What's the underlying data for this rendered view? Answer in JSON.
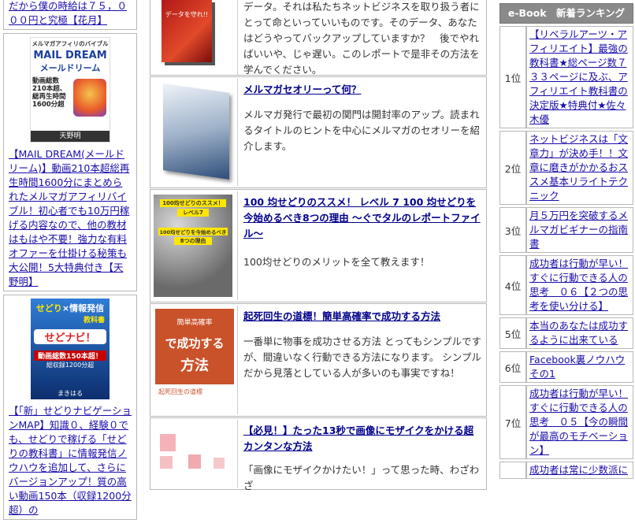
{
  "left": {
    "top_text": "だから僕の時給は７５，０００円と究極【花月】",
    "ad1": {
      "cover_tag": "メルマガアフィリのバイブル",
      "cover_title": "MAIL DREAM",
      "cover_kana": "メールドリーム",
      "cover_lines": [
        "動画総数",
        "210本超、",
        "総再生時間",
        "1600分超"
      ],
      "cover_author": "天野明",
      "link": "【MAIL DREAM(メールドリーム)】動画210本超総再生時間1600分にまとめられたメルマガアフィリバイブル！初心者でも10万円稼げる内容なので、他の教材はもはや不要！強力な有料オファーを仕掛ける秘策も大公開！5大特典付き【天野明】"
    },
    "ad2": {
      "cover_title1": "せどり",
      "cover_title2": "情報発信",
      "cover_title3": "教科書",
      "cover_logo": "せどナビ！",
      "cover_count": "動画総数150本超！",
      "cover_sub": "総収録1200分超",
      "cover_author": "まきはる",
      "link": "【「新」せどりナビゲーションMAP】知識０、経験０でも、せどりで稼げる「せどりの教科書」に情報発信ノウハウを追加して、さらにバージョンアップ！質の高い動画150本（収録1200分超）の"
    }
  },
  "center": {
    "row0": {
      "cover_text": "データを守れ!!",
      "desc": "データ。それは私たちネットビジネスを取り扱う者にとって命といっていいものです。そのデータ、あなたはどうやってバックアップしていますか？　後でやればいいや、じゃ遅い。このレポートで是非その方法を学んでください。"
    },
    "row1": {
      "title": "メルマガセオリーって何？",
      "desc": "メルマガ発行で最初の関門は開封率のアップ。読まれるタイトルのヒントを中心にメルマガのセオリーを紹介します。"
    },
    "row2": {
      "cover_t1": "100均せどりのススメ！",
      "cover_t2": "レベル7",
      "cover_t3": "100均せどりを今始めるべき",
      "cover_t4": "8つの理由",
      "title": "100 均せどりのススメ！ レベル 7 100 均せどりを今始めるべき8つの理由 ～ぐでタルのレポートファイル～",
      "desc": "100均せどりのメリットを全て教えます！"
    },
    "row3": {
      "cover_t1": "簡単高確率",
      "cover_t2": "で成功する",
      "cover_t3": "方法",
      "cover_t4": "起死回生の道標",
      "title": "起死回生の道標！簡単高確率で成功する方法",
      "desc": "一番単に物事を成功させる方法 とってもシンプルですが、間違いなく行動できる方法になります。 シンプルだから見落としている人が多いのも事実ですね！"
    },
    "row4": {
      "title": "【必見！】たった13秒で画像にモザイクをかける超カンタンな方法",
      "desc": "「画像にモザイクかけたい！」って思った時、わざわざ"
    }
  },
  "right": {
    "header": "e-Book　新着ランキング",
    "items": [
      {
        "rank": "1位",
        "title": "【リベラルアーツ・アフィリエイト】最強の教科書★総ページ数７３３ページに及ぶ、アフィリエイト教科書の決定版★特典付★佐々木優"
      },
      {
        "rank": "2位",
        "title": "ネットビジネスは「文章力」が決め手！！文章に磨きがかかるおススメ基本リライトテクニック"
      },
      {
        "rank": "3位",
        "title": "月５万円を突破するメルマガビギナーの指南書"
      },
      {
        "rank": "4位",
        "title": "成功者は行動が早い！すぐに行動できる人の思考　０６【２つの思考を使い分ける】"
      },
      {
        "rank": "5位",
        "title": "本当のあなたは成功するように出来ている"
      },
      {
        "rank": "6位",
        "title": "Facebook裏ノウハウその1"
      },
      {
        "rank": "7位",
        "title": "成功者は行動が早い！すぐに行動できる人の思考　０５【今の瞬間が最高のモチベーション】"
      },
      {
        "rank": "",
        "title": "成功者は常に少数派に"
      }
    ]
  }
}
